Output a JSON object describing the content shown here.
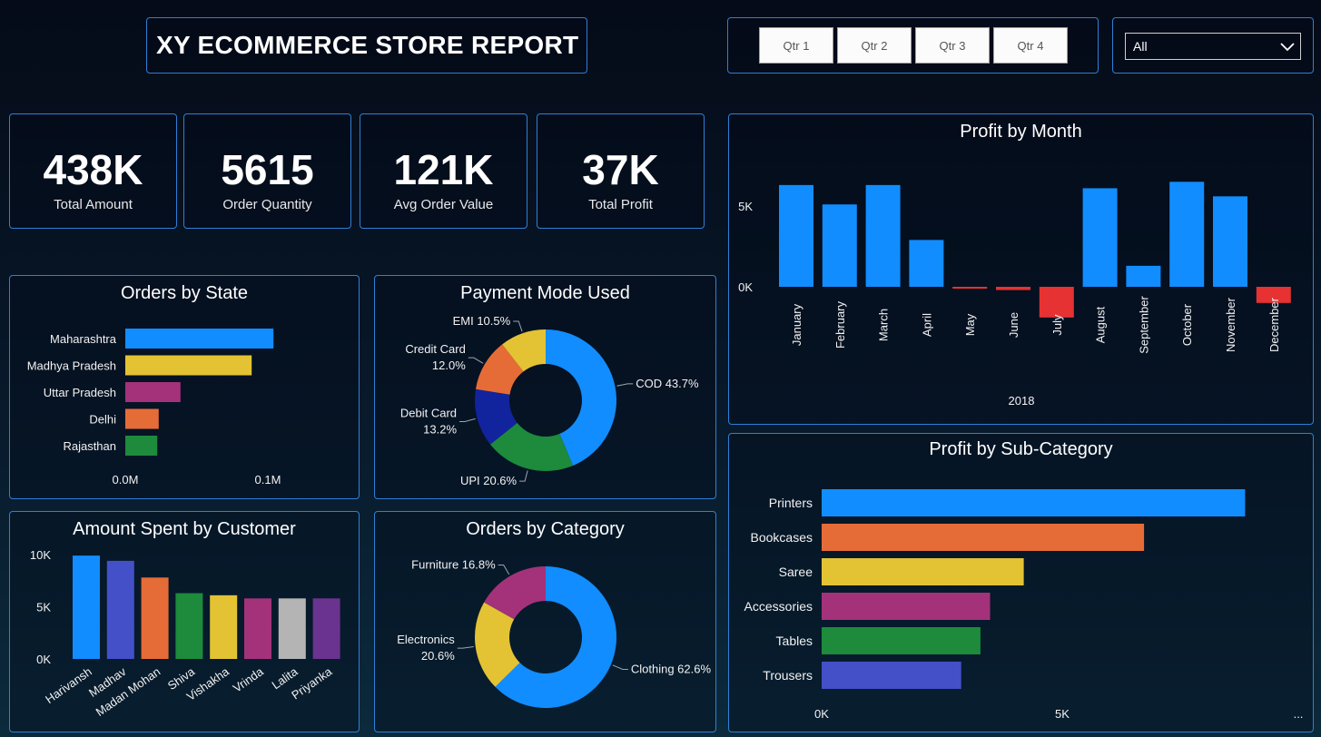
{
  "header": {
    "title": "XY ECOMMERCE STORE REPORT"
  },
  "quarter_slicer": {
    "buttons": [
      "Qtr 1",
      "Qtr 2",
      "Qtr 3",
      "Qtr 4"
    ]
  },
  "dropdown": {
    "selected": "All",
    "icon": "chevron-down-icon"
  },
  "kpis": [
    {
      "value": "438K",
      "label": "Total Amount"
    },
    {
      "value": "5615",
      "label": "Order Quantity"
    },
    {
      "value": "121K",
      "label": "Avg Order Value"
    },
    {
      "value": "37K",
      "label": "Total Profit"
    }
  ],
  "colors": {
    "primary": "#118dff",
    "negative": "#e63232",
    "border": "#2f7fd6"
  },
  "chart_data": [
    {
      "id": "orders_by_state",
      "type": "bar",
      "orientation": "horizontal",
      "title": "Orders by State",
      "categories": [
        "Maharashtra",
        "Madhya Pradesh",
        "Uttar Pradesh",
        "Delhi",
        "Rajasthan"
      ],
      "values": [
        0.102,
        0.087,
        0.038,
        0.023,
        0.022
      ],
      "colors": [
        "#118dff",
        "#e3c334",
        "#a4327b",
        "#e66c37",
        "#1d8a3c"
      ],
      "xticks": [
        "0.0M",
        "0.1M"
      ],
      "xlim": [
        0,
        0.1
      ]
    },
    {
      "id": "payment_mode",
      "type": "pie",
      "donut": true,
      "title": "Payment Mode Used",
      "slices": [
        {
          "label": "COD 43.7%",
          "value": 43.7,
          "color": "#118dff"
        },
        {
          "label": "UPI 20.6%",
          "value": 20.6,
          "color": "#1d8a3c"
        },
        {
          "label": "Debit Card 13.2%",
          "value": 13.2,
          "color": "#12239e"
        },
        {
          "label": "Credit Card 12.0%",
          "value": 12.0,
          "color": "#e66c37"
        },
        {
          "label": "EMI 10.5%",
          "value": 10.5,
          "color": "#e3c334"
        }
      ],
      "label_lines": {
        "COD 43.7%": [
          "COD 43.7%"
        ],
        "UPI 20.6%": [
          "UPI 20.6%"
        ],
        "Debit Card 13.2%": [
          "Debit Card",
          "13.2%"
        ],
        "Credit Card 12.0%": [
          "Credit Card",
          "12.0%"
        ],
        "EMI 10.5%": [
          "EMI 10.5%"
        ]
      }
    },
    {
      "id": "amount_by_customer",
      "type": "bar",
      "title": "Amount Spent by Customer",
      "categories": [
        "Harivansh",
        "Madhav",
        "Madan Mohan",
        "Shiva",
        "Vishakha",
        "Vrinda",
        "Lalita",
        "Priyanka"
      ],
      "values": [
        9900,
        9400,
        7800,
        6300,
        6100,
        5800,
        5800,
        5800
      ],
      "colors": [
        "#118dff",
        "#4450c8",
        "#e66c37",
        "#1d8a3c",
        "#e3c334",
        "#a4327b",
        "#b4b4b4",
        "#6a3390"
      ],
      "yticks": [
        "0K",
        "5K",
        "10K"
      ],
      "ylim": [
        0,
        10000
      ]
    },
    {
      "id": "orders_by_category",
      "type": "pie",
      "donut": true,
      "title": "Orders by Category",
      "slices": [
        {
          "label": "Clothing 62.6%",
          "value": 62.6,
          "color": "#118dff"
        },
        {
          "label": "Electronics 20.6%",
          "value": 20.6,
          "color": "#e3c334"
        },
        {
          "label": "Furniture 16.8%",
          "value": 16.8,
          "color": "#a4327b"
        }
      ],
      "label_lines": {
        "Clothing 62.6%": [
          "Clothing 62.6%"
        ],
        "Electronics 20.6%": [
          "Electronics",
          "20.6%"
        ],
        "Furniture 16.8%": [
          "Furniture 16.8%"
        ]
      }
    },
    {
      "id": "profit_by_month",
      "type": "bar",
      "title": "Profit by Month",
      "categories": [
        "January",
        "February",
        "March",
        "April",
        "May",
        "June",
        "July",
        "August",
        "September",
        "October",
        "November",
        "December"
      ],
      "values": [
        6300,
        5100,
        6300,
        2900,
        -100,
        -200,
        -1900,
        6100,
        1300,
        6500,
        5600,
        -1000
      ],
      "positive_color": "#118dff",
      "negative_color": "#e63232",
      "xlabel": "2018",
      "yticks": [
        "0K",
        "5K"
      ],
      "ylim": [
        -2500,
        8000
      ]
    },
    {
      "id": "profit_by_subcategory",
      "type": "bar",
      "orientation": "horizontal",
      "title": "Profit by Sub-Category",
      "categories": [
        "Printers",
        "Bookcases",
        "Saree",
        "Accessories",
        "Tables",
        "Trousers"
      ],
      "values": [
        8800,
        6700,
        4200,
        3500,
        3300,
        2900
      ],
      "colors": [
        "#118dff",
        "#e66c37",
        "#e3c334",
        "#a4327b",
        "#1d8a3c",
        "#4450c8"
      ],
      "xticks": [
        "0K",
        "5K"
      ],
      "xlim": [
        0,
        5000
      ],
      "more": "..."
    }
  ]
}
